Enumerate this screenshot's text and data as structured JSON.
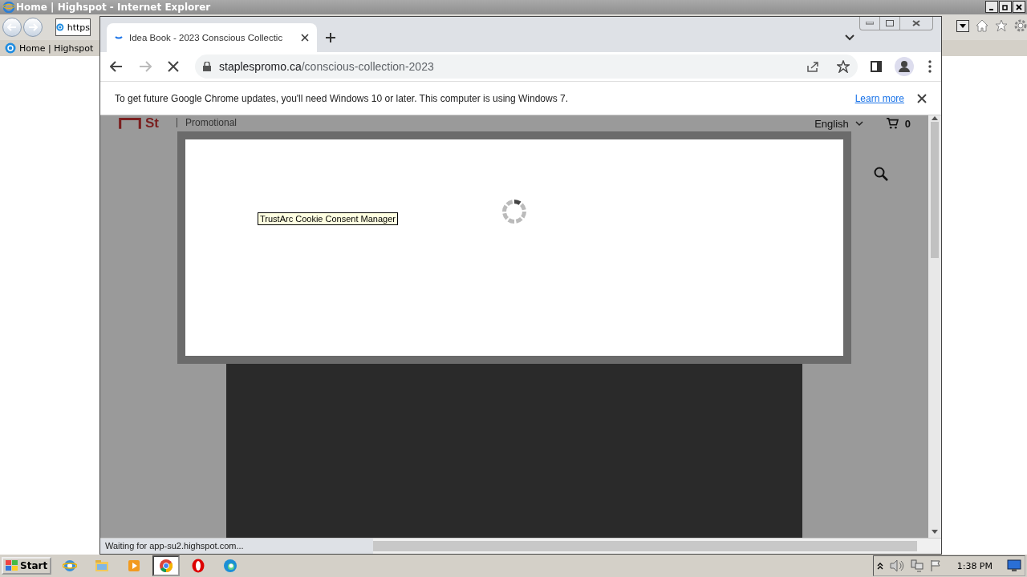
{
  "ie_window": {
    "title": "Home | Highspot - Internet Explorer",
    "address": "https",
    "favorites": [
      {
        "label": "Home | Highspot"
      }
    ]
  },
  "chrome_window": {
    "tabs": [
      {
        "label": "Idea Book - 2023 Conscious Collectic",
        "selected": true,
        "loading": true
      }
    ],
    "url_host": "staplespromo.ca",
    "url_path": "/conscious-collection-2023",
    "loading": true,
    "infobar": {
      "message": "To get future Google Chrome updates, you'll need Windows 10 or later. This computer is using Windows 7.",
      "link": "Learn more"
    },
    "page": {
      "logo": "St",
      "tagline": "Promotional",
      "language": "English",
      "cart_count": "0",
      "dialog": {
        "tooltip": "TrustArc Cookie Consent Manager",
        "loading": true
      }
    },
    "status": "Waiting for app-su2.highspot.com..."
  },
  "taskbar": {
    "start": "Start",
    "apps": [
      {
        "kind": "ie",
        "selected": false
      },
      {
        "kind": "folder",
        "selected": false
      },
      {
        "kind": "media",
        "selected": false
      },
      {
        "kind": "chrome",
        "selected": true
      },
      {
        "kind": "opera",
        "selected": false
      },
      {
        "kind": "edge",
        "selected": false
      }
    ],
    "clock": "1:38 PM"
  }
}
